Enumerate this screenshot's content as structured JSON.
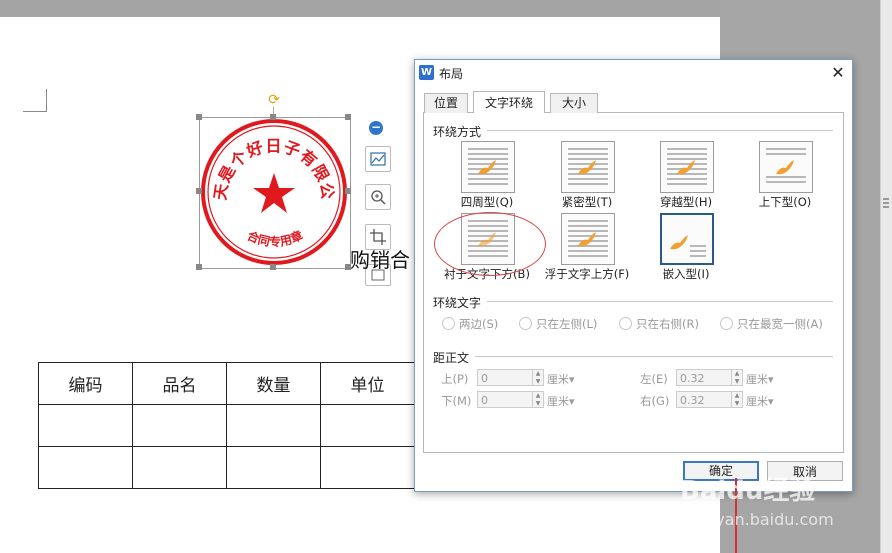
{
  "document": {
    "title_text": "购销合",
    "table": {
      "headers": [
        "编码",
        "品名",
        "数量",
        "单位"
      ],
      "rows": [
        [
          "",
          "",
          "",
          ""
        ],
        [
          "",
          "",
          "",
          ""
        ]
      ]
    }
  },
  "stamp": {
    "arc_text": "今天是个好日子有限公司",
    "bottom_text": "合同专用章",
    "color": "#e0191f"
  },
  "dialog": {
    "icon_label": "W",
    "title": "布局",
    "close_label": "✕",
    "tabs": [
      {
        "label": "位置",
        "active": false
      },
      {
        "label": "文字环绕",
        "active": true
      },
      {
        "label": "大小",
        "active": false
      }
    ],
    "wrap_style": {
      "heading": "环绕方式",
      "options": [
        {
          "label": "四周型(Q)",
          "selected": false
        },
        {
          "label": "紧密型(T)",
          "selected": false
        },
        {
          "label": "穿越型(H)",
          "selected": false
        },
        {
          "label": "上下型(O)",
          "selected": false
        },
        {
          "label": "衬于文字下方(B)",
          "selected": false
        },
        {
          "label": "浮于文字上方(F)",
          "selected": false
        },
        {
          "label": "嵌入型(I)",
          "selected": true
        }
      ]
    },
    "wrap_text": {
      "heading": "环绕文字",
      "options": [
        "两边(S)",
        "只在左侧(L)",
        "只在右侧(R)",
        "只在最宽一侧(A)"
      ]
    },
    "distance": {
      "heading": "距正文",
      "fields": [
        {
          "label": "上(P)",
          "value": "0",
          "unit": "厘米▾"
        },
        {
          "label": "下(M)",
          "value": "0",
          "unit": "厘米▾"
        },
        {
          "label": "左(E)",
          "value": "0.32",
          "unit": "厘米▾"
        },
        {
          "label": "右(G)",
          "value": "0.32",
          "unit": "厘米▾"
        }
      ]
    },
    "ok_label": "确定",
    "cancel_label": "取消"
  },
  "watermark": {
    "brand": "Baidu经验",
    "url": "jingyan.baidu.com"
  },
  "colors": {
    "accent": "#2f6fcd",
    "highlight_circle": "#d84848",
    "flame": "#f0a030"
  }
}
